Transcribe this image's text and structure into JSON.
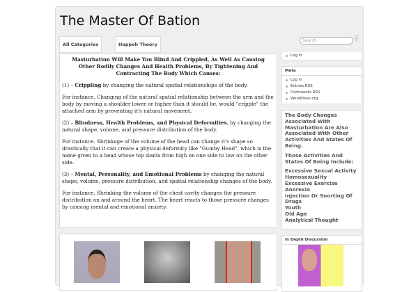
{
  "site_title": "The Master Of Bation",
  "tabs": [
    "All Categories",
    "Happeh Theory"
  ],
  "search_placeholder": "Search",
  "main": {
    "heading": "Masturbation Will Make You Blind And Crippled, As Well As Causing Other Bodily Changes And Health Problems, By Tightening And Contracting The Body Which Causes:",
    "items": [
      {
        "prefix": "(1) – ",
        "bold": "Crippling",
        "text": " by changing the natural spatial relationships of the body.",
        "example": "For instance. Changing of the natural spatial relationship between the arm and the body by moving a shoulder lower or higher than it should be, would \"cripple\" the attached arm by preventing it's natural movement."
      },
      {
        "prefix": "(2) – ",
        "bold": "Blindness, Health Problems, and Physical Deformities",
        "text": ", by changing the natural shape, volume, and pressure distribution of the body.",
        "example": "For instance. Shrinkage of the volume of the head can change it's shape so drastically that it can create a physical deformity like \"Gumby Head\", which is the name given to a head whose top slants from high on one side to low on the other side."
      },
      {
        "prefix": "(3) – ",
        "bold": "Mental, Personality, and Emotional Problems",
        "text": " by changing the natural shape, volume, pressure distribution, and spatial relationship changes of the body.",
        "example": "For instance. Shrinking the volume of the chest cavity changes the pressure distribution on and around the heart. The heart reacts to those pressure changes by causing mental and emotional anxiety."
      }
    ]
  },
  "sidebar": {
    "login_widget": [
      "Log in"
    ],
    "meta_title": "Meta",
    "meta_items": [
      "Log in",
      "Entries RSS",
      "Comments RSS",
      "WordPress.org"
    ],
    "changes_heading": "The Body Changes Associated With Masturbation Are Also Associated With Other Activities And States Of Being.",
    "changes_sub": "Those Activities And States Of Being Include:",
    "activities": [
      "Excessive Sexual Activity",
      "Homosexuality",
      "Excessive Exercise",
      "Anorexia",
      "Injection Or Snorting Of Drugs",
      "Youth",
      "Old Age",
      "Analytical Thought"
    ],
    "discussion_title": "In Depth Discussion"
  }
}
